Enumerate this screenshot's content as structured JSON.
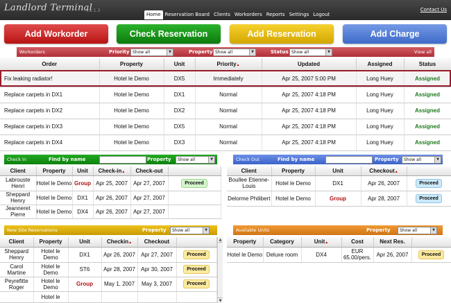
{
  "app": {
    "title": "Landlord Terminal",
    "version": "v.1.1.3",
    "contact": "Contact Us"
  },
  "nav": [
    "Home",
    "Reservation Board",
    "Clients",
    "Workorders",
    "Reports",
    "Settings",
    "Logout"
  ],
  "buttons": {
    "add_workorder": "Add Workorder",
    "check_reservation": "Check Reservation",
    "add_reservation": "Add Reservation",
    "add_charge": "Add Charge"
  },
  "workorders": {
    "bar": {
      "title": "Workorders",
      "priority_label": "Priority",
      "priority_value": "Show all",
      "property_label": "Property",
      "property_value": "Show all",
      "status_label": "Status",
      "status_value": "Show all",
      "view_all": "View all"
    },
    "columns": [
      "Order",
      "Property",
      "Unit",
      "Priority",
      "Updated",
      "Assigned",
      "Status"
    ],
    "rows": [
      [
        "Fix leaking radiator!",
        "Hotel le Demo",
        "DX5",
        "Immediately",
        "Apr 25, 2007 5:00 PM",
        "Long Huey",
        "Assigned"
      ],
      [
        "Replace carpets in DX1",
        "Hotel le Demo",
        "DX1",
        "Normal",
        "Apr 25, 2007 4:18 PM",
        "Long Huey",
        "Assigned"
      ],
      [
        "Replace carpets in DX2",
        "Hotel le Demo",
        "DX2",
        "Normal",
        "Apr 25, 2007 4:18 PM",
        "Long Huey",
        "Assigned"
      ],
      [
        "Replace carpets in DX3",
        "Hotel le Demo",
        "DX5",
        "Normal",
        "Apr 25, 2007 4:18 PM",
        "Long Huey",
        "Assigned"
      ],
      [
        "Replace carpets in DX4",
        "Hotel le Demo",
        "DX3",
        "Normal",
        "Apr 25, 2007 4:18 PM",
        "Long Huey",
        "Assigned"
      ]
    ]
  },
  "checkin": {
    "bar": {
      "title": "Check In",
      "find_label": "Find by name",
      "property_label": "Property",
      "property_value": "Show all"
    },
    "columns": [
      "Client",
      "Property",
      "Unit",
      "Check-in",
      "Check-out",
      ""
    ],
    "rows": [
      [
        "Labrouste Henri",
        "Hotel le Demo",
        "Group",
        "Apr 25, 2007",
        "Apr 27, 2007",
        "Proceed"
      ],
      [
        "Sheppard Henry",
        "Hotel le Demo",
        "DX1",
        "Apr 26, 2007",
        "Apr 27, 2007",
        ""
      ],
      [
        "Jeanneret Pierre",
        "Hotel le Demo",
        "DX4",
        "Apr 26, 2007",
        "Apr 27, 2007",
        ""
      ]
    ]
  },
  "checkout": {
    "bar": {
      "title": "Check Out",
      "find_label": "Find by name",
      "property_label": "Property",
      "property_value": "Show all"
    },
    "columns": [
      "Client",
      "Property",
      "Unit",
      "Checkout",
      ""
    ],
    "rows": [
      [
        "Boullee Etienne-Louis",
        "Hotel le Demo",
        "DX1",
        "Apr 26, 2007",
        "Proceed"
      ],
      [
        "Delorme Philibert",
        "Hotel le Demo",
        "Group",
        "Apr 28, 2007",
        "Proceed"
      ]
    ]
  },
  "newsite": {
    "bar": {
      "title": "New Site Reservations",
      "property_label": "Property",
      "property_value": "Show all"
    },
    "columns": [
      "Client",
      "Property",
      "Unit",
      "Checkin",
      "Checkout",
      ""
    ],
    "rows": [
      [
        "Sheppard Henry",
        "Hotel le Demo",
        "DX1",
        "Apr 26, 2007",
        "Apr 27, 2007",
        "Proceed"
      ],
      [
        "Carol Martine",
        "Hotel le Demo",
        "ST6",
        "Apr 28, 2007",
        "Apr 30, 2007",
        "Proceed"
      ],
      [
        "Peyrefitte Roger",
        "Hotel le Demo",
        "Group",
        "May 1, 2007",
        "May 3, 2007",
        "Proceed"
      ],
      [
        "",
        "Hotel le",
        "",
        "",
        "",
        ""
      ]
    ]
  },
  "units": {
    "bar": {
      "title": "Available Units",
      "property_label": "Property",
      "property_value": "Show all"
    },
    "columns": [
      "Property",
      "Category",
      "Unit",
      "Cost",
      "Next Res.",
      ""
    ],
    "rows": [
      [
        "Hotel le Demo",
        "Deluxe room",
        "DX4",
        "EUR 65.00/pers.",
        "Apr 26, 2007",
        "Proceed"
      ]
    ]
  },
  "colors": {
    "workorders": "#c4474f",
    "checkin": "#1a9a1a",
    "checkout": "#5277d6",
    "newsite": "#d9a60a",
    "units": "#e08a22"
  }
}
